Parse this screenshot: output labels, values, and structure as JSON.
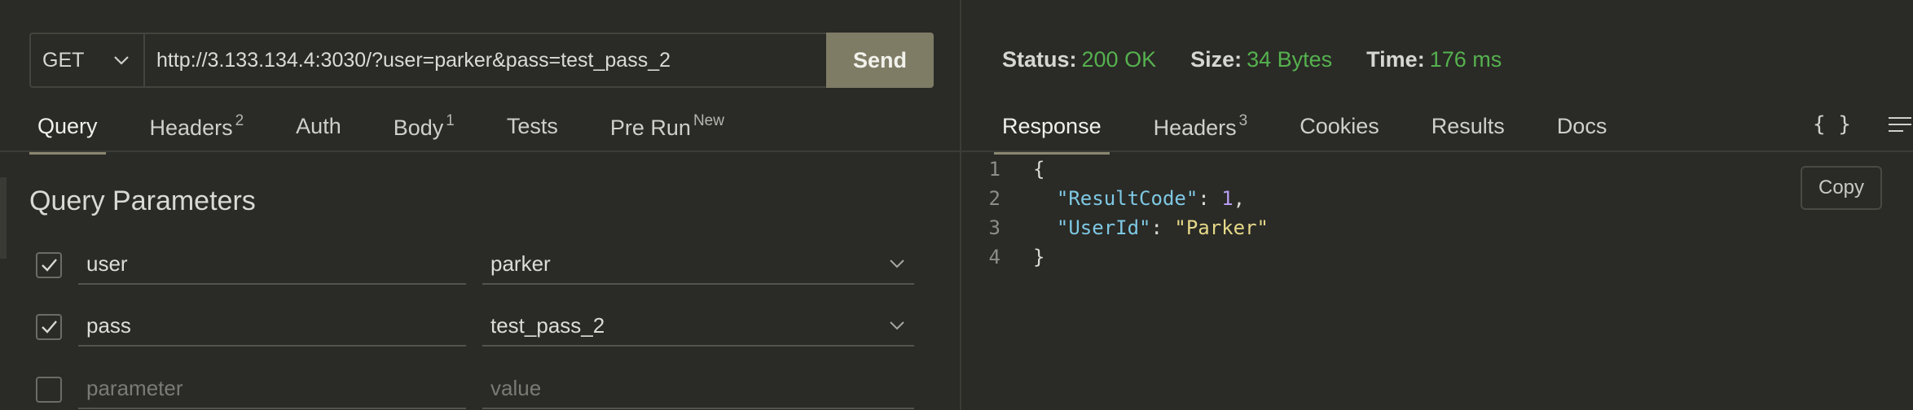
{
  "request": {
    "method": "GET",
    "url": "http://3.133.134.4:3030/?user=parker&pass=test_pass_2",
    "send_label": "Send"
  },
  "left_tabs": [
    {
      "label": "Query",
      "badge": ""
    },
    {
      "label": "Headers",
      "badge": "2"
    },
    {
      "label": "Auth",
      "badge": ""
    },
    {
      "label": "Body",
      "badge": "1"
    },
    {
      "label": "Tests",
      "badge": ""
    },
    {
      "label": "Pre Run",
      "badge": "New"
    }
  ],
  "query": {
    "title": "Query Parameters",
    "params": [
      {
        "checked": true,
        "key": "user",
        "value": "parker"
      },
      {
        "checked": true,
        "key": "pass",
        "value": "test_pass_2"
      }
    ],
    "new_row": {
      "checked": false,
      "key_placeholder": "parameter",
      "value_placeholder": "value"
    }
  },
  "response_status": {
    "status_label": "Status:",
    "status_value": "200 OK",
    "size_label": "Size:",
    "size_value": "34 Bytes",
    "time_label": "Time:",
    "time_value": "176 ms"
  },
  "right_tabs": [
    {
      "label": "Response",
      "badge": ""
    },
    {
      "label": "Headers",
      "badge": "3"
    },
    {
      "label": "Cookies",
      "badge": ""
    },
    {
      "label": "Results",
      "badge": ""
    },
    {
      "label": "Docs",
      "badge": ""
    }
  ],
  "toolbar": {
    "braces": "{ }",
    "copy_label": "Copy"
  },
  "response_body": {
    "line_numbers": [
      "1",
      "2",
      "3",
      "4"
    ],
    "open_brace": "{",
    "close_brace": "}",
    "fields": [
      {
        "key": "\"ResultCode\"",
        "sep": ": ",
        "value": "1",
        "trail": ","
      },
      {
        "key": "\"UserId\"",
        "sep": ": ",
        "value": "\"Parker\"",
        "trail": ""
      }
    ]
  },
  "colors": {
    "accent": "#8a8770",
    "send_bg": "#7f7c66",
    "status_green": "#55b14f"
  }
}
